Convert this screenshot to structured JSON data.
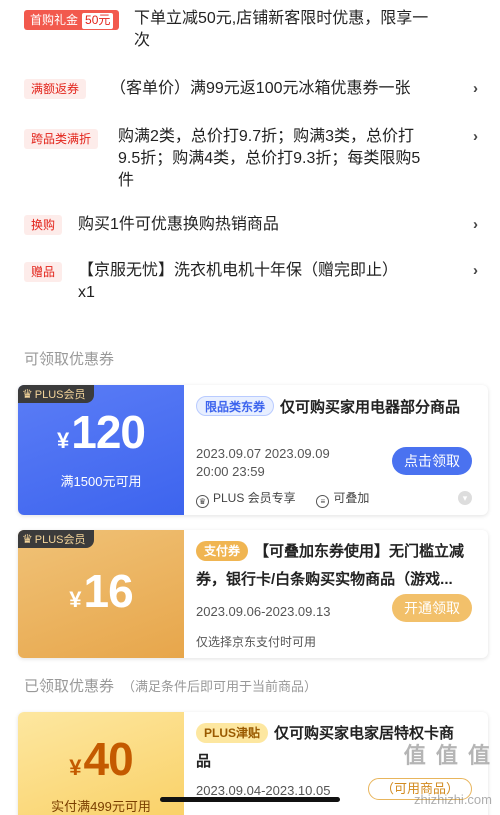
{
  "promotions": [
    {
      "tag": "首购礼金",
      "tag_amount": "50元",
      "text_line1": "下单立减50元,店铺新客限时优惠，限享一",
      "text_line2": "次"
    },
    {
      "tag": "满额返券",
      "text_line1": "（客单价）满99元返100元冰箱优惠券一张"
    },
    {
      "tag": "跨品类满折",
      "text_line1": "购满2类，总价打9.7折；购满3类，总价打",
      "text_line2": "9.5折；购满4类，总价打9.3折；每类限购5",
      "text_line3": "件"
    },
    {
      "tag": "换购",
      "text_line1": "购买1件可优惠换购热销商品"
    },
    {
      "tag": "赠品",
      "text_line1": "【京服无忧】洗衣机电机十年保（赠完即止）",
      "text_line2": "x1"
    }
  ],
  "sections": {
    "available": "可领取优惠券",
    "claimed": "已领取优惠券",
    "claimed_sub": "（满足条件后即可用于当前商品）"
  },
  "coupons": [
    {
      "badge": "PLUS会员",
      "currency": "¥",
      "amount": "120",
      "condition": "满1500元可用",
      "tag": "限品类东券",
      "title": "仅可购买家用电器部分商品",
      "date_line1": "2023.09.07 2023.09.09",
      "date_line2": "20:00 23:59",
      "date_sep": "_",
      "button": "点击领取",
      "meta1": "PLUS 会员专享",
      "meta2": "可叠加"
    },
    {
      "badge": "PLUS会员",
      "currency": "¥",
      "amount": "16",
      "tag": "支付券",
      "title_line1": "【可叠加东券使用】无门槛立减",
      "title_line2": "券，银行卡/白条购买实物商品（游戏...",
      "date": "2023.09.06-2023.09.13",
      "button": "开通领取",
      "note": "仅选择京东支付时可用"
    },
    {
      "currency": "¥",
      "amount": "40",
      "condition": "实付满499元可用",
      "tag": "PLUS津贴",
      "title_line1": "仅可购买家电家居特权卡商",
      "title_line2": "品",
      "date": "2023.09.04-2023.10.05",
      "button": "（可用商品）"
    }
  ],
  "watermark": {
    "text": "值 值 值",
    "url": "zhizhizhi.com"
  },
  "colors": {
    "accent_red": "#e2231a",
    "blue": "#3d64ee",
    "gold": "#e7a64b"
  }
}
